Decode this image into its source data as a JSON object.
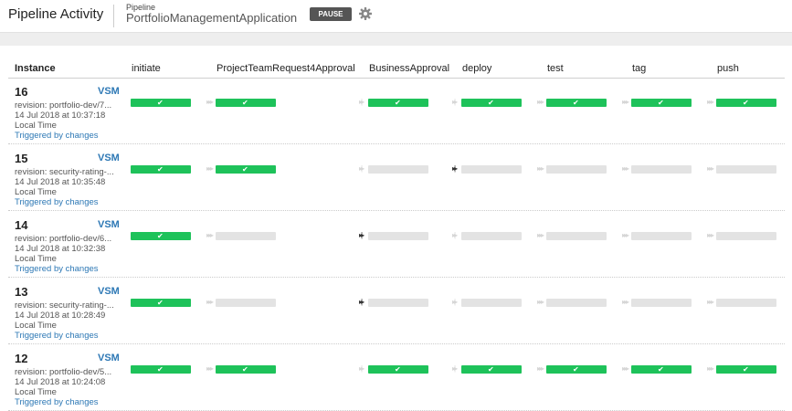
{
  "header": {
    "title": "Pipeline Activity",
    "pipeline_label": "Pipeline",
    "pipeline_name": "PortfolioManagementApplication",
    "pause_label": "PAUSE"
  },
  "columns": {
    "instance": "Instance",
    "stages": [
      "initiate",
      "ProjectTeamRequest4Approval",
      "BusinessApproval",
      "deploy",
      "test",
      "tag",
      "push"
    ]
  },
  "colors": {
    "passed": "#1ec25a",
    "not_run": "#e3e3e3",
    "link": "#2d78b5"
  },
  "rows": [
    {
      "counter": "16",
      "vsm": "VSM",
      "revision": "revision: portfolio-dev/7...",
      "date": "14 Jul 2018 at 10:37:18",
      "tz": "Local Time",
      "trigger": "Triggered by changes",
      "stages": [
        "passed",
        "passed",
        "passed",
        "passed",
        "passed",
        "passed",
        "passed"
      ],
      "arrows": [
        "auto",
        "manual",
        "manual",
        "auto",
        "auto",
        "auto",
        "auto"
      ]
    },
    {
      "counter": "15",
      "vsm": "VSM",
      "revision": "revision: security-rating-...",
      "date": "14 Jul 2018 at 10:35:48",
      "tz": "Local Time",
      "trigger": "Triggered by changes",
      "stages": [
        "passed",
        "passed",
        "notrun",
        "notrun",
        "notrun",
        "notrun",
        "notrun"
      ],
      "arrows": [
        "auto",
        "manual",
        "manual-active",
        "auto",
        "auto",
        "auto",
        "auto"
      ]
    },
    {
      "counter": "14",
      "vsm": "VSM",
      "revision": "revision: portfolio-dev/6...",
      "date": "14 Jul 2018 at 10:32:38",
      "tz": "Local Time",
      "trigger": "Triggered by changes",
      "stages": [
        "passed",
        "notrun",
        "notrun",
        "notrun",
        "notrun",
        "notrun",
        "notrun"
      ],
      "arrows": [
        "auto",
        "manual-active",
        "manual",
        "auto",
        "auto",
        "auto",
        "auto"
      ]
    },
    {
      "counter": "13",
      "vsm": "VSM",
      "revision": "revision: security-rating-...",
      "date": "14 Jul 2018 at 10:28:49",
      "tz": "Local Time",
      "trigger": "Triggered by changes",
      "stages": [
        "passed",
        "notrun",
        "notrun",
        "notrun",
        "notrun",
        "notrun",
        "notrun"
      ],
      "arrows": [
        "auto",
        "manual-active",
        "manual",
        "auto",
        "auto",
        "auto",
        "auto"
      ]
    },
    {
      "counter": "12",
      "vsm": "VSM",
      "revision": "revision: portfolio-dev/5...",
      "date": "14 Jul 2018 at 10:24:08",
      "tz": "Local Time",
      "trigger": "Triggered by changes",
      "stages": [
        "passed",
        "passed",
        "passed",
        "passed",
        "passed",
        "passed",
        "passed"
      ],
      "arrows": [
        "auto",
        "manual",
        "manual",
        "auto",
        "auto",
        "auto",
        "auto"
      ]
    }
  ]
}
